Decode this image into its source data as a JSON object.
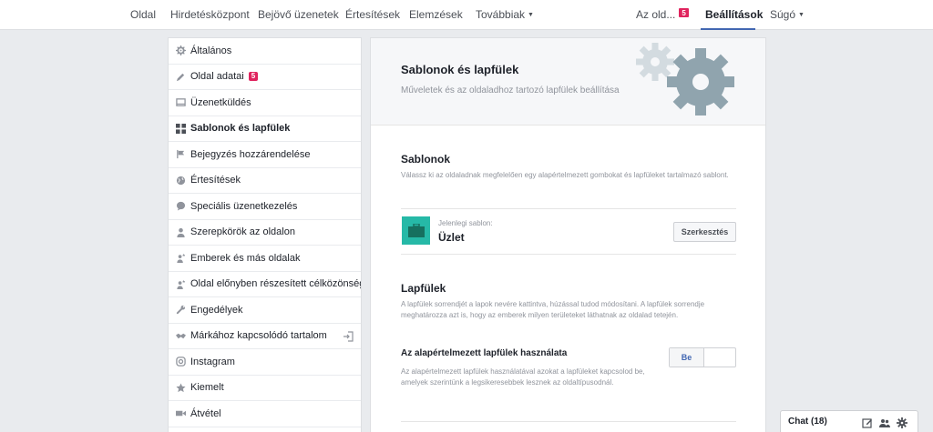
{
  "topnav": {
    "items": [
      "Oldal",
      "Hirdetésközpont",
      "Bejövő üzenetek",
      "Értesítések",
      "Elemzések",
      "Továbbiak"
    ],
    "page_switcher": "Az old...",
    "page_switcher_badge": "5",
    "settings": "Beállítások",
    "help": "Súgó"
  },
  "sidebar": {
    "items": [
      {
        "label": "Általános",
        "icon": "gear-icon"
      },
      {
        "label": "Oldal adatai",
        "icon": "pencil-icon",
        "badge": "5"
      },
      {
        "label": "Üzenetküldés",
        "icon": "message-icon"
      },
      {
        "label": "Sablonok és lapfülek",
        "icon": "grid-icon",
        "active": true
      },
      {
        "label": "Bejegyzés hozzárendelése",
        "icon": "flag-icon"
      },
      {
        "label": "Értesítések",
        "icon": "globe-icon"
      },
      {
        "label": "Speciális üzenetkezelés",
        "icon": "chat-bubble-icon"
      },
      {
        "label": "Szerepkörök az oldalon",
        "icon": "person-icon"
      },
      {
        "label": "Emberek és más oldalak",
        "icon": "person-star-icon"
      },
      {
        "label": "Oldal előnyben részesített célközönsége",
        "icon": "person-star-icon"
      },
      {
        "label": "Engedélyek",
        "icon": "wrench-icon"
      },
      {
        "label": "Márkához kapcsolódó tartalom",
        "icon": "handshake-icon"
      },
      {
        "label": "Instagram",
        "icon": "instagram-icon"
      },
      {
        "label": "Kiemelt",
        "icon": "star-icon"
      },
      {
        "label": "Átvétel",
        "icon": "video-icon"
      }
    ]
  },
  "main": {
    "title": "Sablonok és lapfülek",
    "subtitle": "Műveletek és az oldaladhoz tartozó lapfülek beállítása",
    "templates": {
      "title": "Sablonok",
      "description": "Válassz ki az oldaladnak megfelelően egy alapértelmezett gombokat és lapfüleket tartalmazó sablont.",
      "current_label": "Jelenlegi sablon:",
      "current_value": "Üzlet",
      "edit_button": "Szerkesztés"
    },
    "tabs": {
      "title": "Lapfülek",
      "description": "A lapfülek sorrendjét a lapok nevére kattintva, húzással tudod módosítani. A lapfülek sorrendje meghatározza azt is, hogy az emberek milyen területeket láthatnak az oldalad tetején.",
      "default_tabs_title": "Az alapértelmezett lapfülek használata",
      "default_tabs_desc": "Az alapértelmezett lapfülek használatával azokat a lapfüleket kapcsolod be, amelyek szerintünk a legsikeresebbek lesznek az oldaltípusodnál.",
      "toggle_on": "Be"
    }
  },
  "chat": {
    "label": "Chat (18)"
  },
  "colors": {
    "accent": "#4267b2",
    "badge": "#e0245e",
    "template_icon": "#26b9a7"
  }
}
